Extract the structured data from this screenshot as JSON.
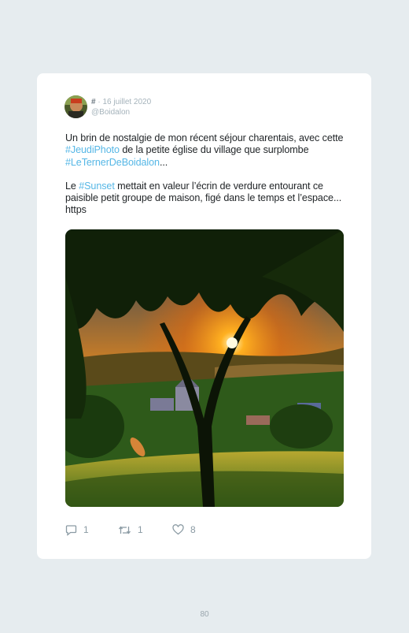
{
  "tweet": {
    "hash_symbol": "#",
    "separator": "·",
    "date": "16 juillet 2020",
    "handle": "@Boidalon",
    "paragraph1": {
      "t1": "Un brin de nostalgie de mon récent séjour charentais, avec cette ",
      "tag1": "#JeudiPhoto",
      "t2": " de la petite église du village que surplombe ",
      "tag2": "#LeTernerDeBoidalon",
      "t3": "..."
    },
    "paragraph2": {
      "t1": "Le ",
      "tag1": "#Sunset",
      "t2": " mettait en valeur l’écrin de verdure entourant ce paisible petit groupe de maison, figé dans le temps et l’espace... https"
    }
  },
  "actions": {
    "replies": "1",
    "retweets": "1",
    "likes": "8"
  },
  "page_number": "80",
  "colors": {
    "hashtag": "#56b7e6",
    "background": "#e6ecef",
    "card": "#ffffff",
    "muted": "#8a9aa3"
  },
  "icons": [
    "reply-icon",
    "retweet-icon",
    "heart-icon"
  ]
}
